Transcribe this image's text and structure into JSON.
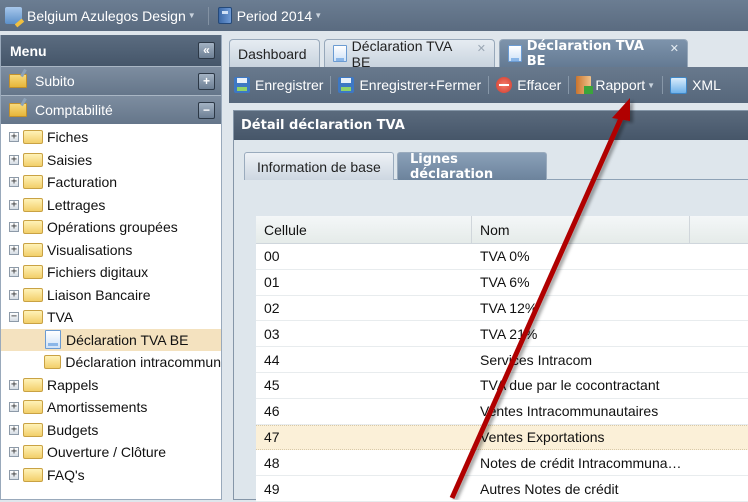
{
  "topbar": {
    "company": "Belgium Azulegos Design",
    "period": "Period 2014"
  },
  "sidebar": {
    "title": "Menu",
    "collapse_icon": "«",
    "accordions": [
      {
        "label": "Subito",
        "toggle": "+"
      },
      {
        "label": "Comptabilité",
        "toggle": "−"
      }
    ],
    "tree": [
      {
        "label": "Fiches",
        "expander": "+"
      },
      {
        "label": "Saisies",
        "expander": "+"
      },
      {
        "label": "Facturation",
        "expander": "+"
      },
      {
        "label": "Lettrages",
        "expander": "+"
      },
      {
        "label": "Opérations groupées",
        "expander": "+"
      },
      {
        "label": "Visualisations",
        "expander": "+"
      },
      {
        "label": "Fichiers digitaux",
        "expander": "+"
      },
      {
        "label": "Liaison Bancaire",
        "expander": "+"
      },
      {
        "label": "TVA",
        "expander": "−"
      },
      {
        "label": "Déclaration TVA BE"
      },
      {
        "label": "Déclaration intracommun"
      },
      {
        "label": "Rappels",
        "expander": "+"
      },
      {
        "label": "Amortissements",
        "expander": "+"
      },
      {
        "label": "Budgets",
        "expander": "+"
      },
      {
        "label": "Ouverture / Clôture",
        "expander": "+"
      },
      {
        "label": "FAQ's",
        "expander": "+"
      }
    ]
  },
  "tabs": [
    {
      "label": "Dashboard"
    },
    {
      "label": "Déclaration TVA BE",
      "close": "✕"
    },
    {
      "label": "Déclaration TVA BE",
      "close": "✕"
    }
  ],
  "toolbar": {
    "save": "Enregistrer",
    "save_close": "Enregistrer+Fermer",
    "delete": "Effacer",
    "report": "Rapport",
    "xml": "XML"
  },
  "panel": {
    "title": "Détail déclaration TVA",
    "tabs": [
      "Information de base",
      "Lignes déclaration"
    ]
  },
  "grid": {
    "columns": [
      "Cellule",
      "Nom",
      ""
    ],
    "rows": [
      {
        "cellule": "00",
        "nom": "TVA 0%"
      },
      {
        "cellule": "01",
        "nom": "TVA 6%"
      },
      {
        "cellule": "02",
        "nom": "TVA 12%"
      },
      {
        "cellule": "03",
        "nom": "TVA 21%"
      },
      {
        "cellule": "44",
        "nom": "Services Intracom"
      },
      {
        "cellule": "45",
        "nom": "TVA due par le cocontractant"
      },
      {
        "cellule": "46",
        "nom": "Ventes Intracommunautaires"
      },
      {
        "cellule": "47",
        "nom": "Ventes Exportations"
      },
      {
        "cellule": "48",
        "nom": "Notes de crédit Intracommuna…"
      },
      {
        "cellule": "49",
        "nom": "Autres Notes de crédit"
      }
    ]
  },
  "annotation": {
    "color": "#b00000"
  }
}
